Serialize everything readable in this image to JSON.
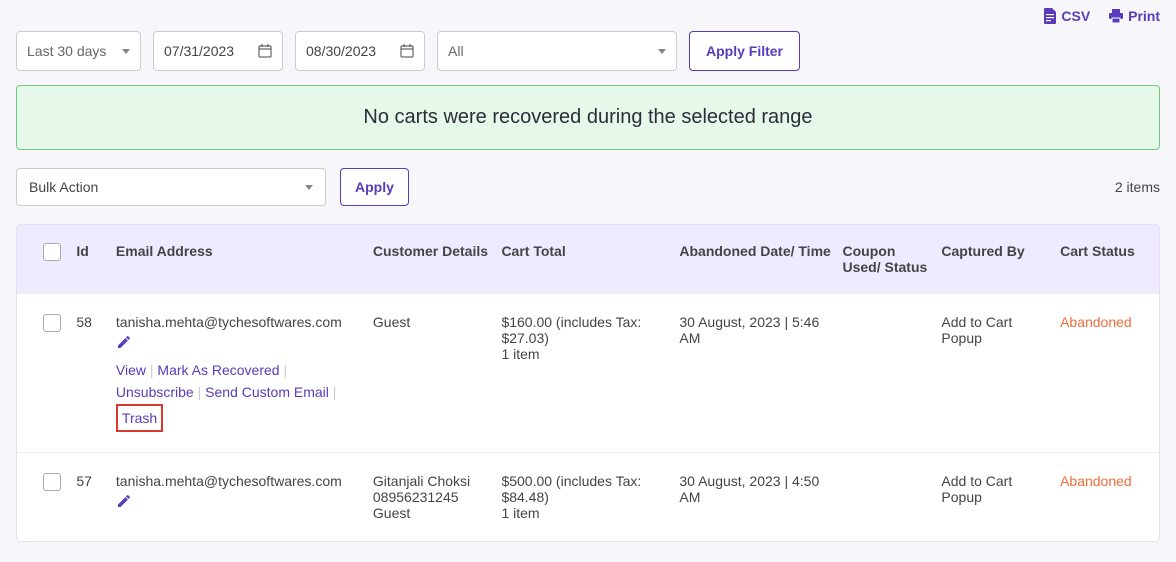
{
  "topActions": {
    "csv": "CSV",
    "print": "Print"
  },
  "filters": {
    "range": "Last 30 days",
    "dateFrom": "07/31/2023",
    "dateTo": "08/30/2023",
    "statusFilter": "All",
    "applyFilter": "Apply Filter"
  },
  "alert": "No carts were recovered during the selected range",
  "bulk": {
    "select": "Bulk Action",
    "apply": "Apply",
    "count": "2 items"
  },
  "columns": {
    "id": "Id",
    "email": "Email Address",
    "customer": "Customer Details",
    "total": "Cart Total",
    "date": "Abandoned Date/ Time",
    "coupon": "Coupon Used/ Status",
    "captured": "Captured By",
    "status": "Cart Status"
  },
  "rowActions": {
    "view": "View",
    "markRecovered": "Mark As Recovered",
    "unsubscribe": "Unsubscribe",
    "sendCustomEmail": "Send Custom Email",
    "trash": "Trash"
  },
  "rows": [
    {
      "id": "58",
      "email": "tanisha.mehta@tychesoftwares.com",
      "customerLines": [
        "Guest"
      ],
      "totalLines": [
        "$160.00 (includes Tax: $27.03)",
        "1 item"
      ],
      "dateLines": [
        "30 August, 2023 | 5:46 AM"
      ],
      "coupon": "",
      "captured": "Add to Cart Popup",
      "status": "Abandoned",
      "showActions": true
    },
    {
      "id": "57",
      "email": "tanisha.mehta@tychesoftwares.com",
      "customerLines": [
        "Gitanjali Choksi",
        "08956231245",
        "Guest"
      ],
      "totalLines": [
        "$500.00 (includes Tax: $84.48)",
        "1 item"
      ],
      "dateLines": [
        "30 August, 2023 | 4:50 AM"
      ],
      "coupon": "",
      "captured": "Add to Cart Popup",
      "status": "Abandoned",
      "showActions": false
    }
  ]
}
